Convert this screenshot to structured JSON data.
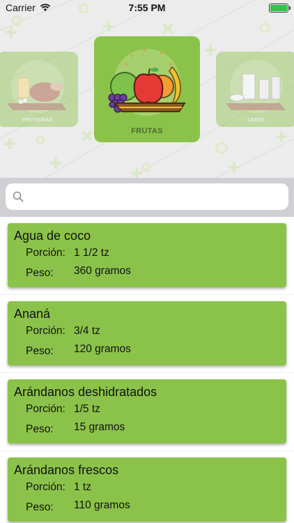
{
  "status_bar": {
    "carrier": "Carrier",
    "time": "7:55 PM",
    "battery_color": "#33c24a"
  },
  "categories": [
    {
      "label": "PROTEÍNAS",
      "state": "inactive"
    },
    {
      "label": "FRUTAS",
      "state": "active"
    },
    {
      "label": "LEBES",
      "state": "inactive"
    }
  ],
  "search": {
    "placeholder": "",
    "value": ""
  },
  "labels": {
    "portion": "Porción:",
    "weight": "Peso:"
  },
  "foods": [
    {
      "name": "Agua de coco",
      "portion": "1 1/2 tz",
      "weight": "360 gramos"
    },
    {
      "name": "Ananá",
      "portion": "3/4 tz",
      "weight": "120 gramos"
    },
    {
      "name": "Arándanos deshidratados",
      "portion": "1/5 tz",
      "weight": "15 gramos"
    },
    {
      "name": "Arándanos frescos",
      "portion": "1 tz",
      "weight": "110 gramos"
    }
  ],
  "colors": {
    "card": "#8bc34a",
    "header_bg": "#ececec",
    "search_band": "#cfcfd4"
  }
}
